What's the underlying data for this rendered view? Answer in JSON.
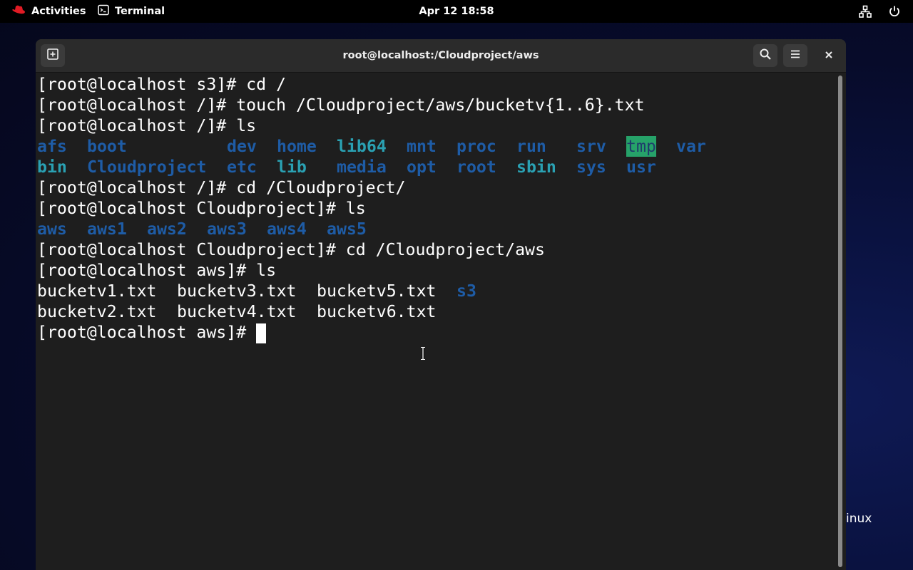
{
  "topbar": {
    "activities_label": "Activities",
    "app_label": "Terminal",
    "clock": "Apr 12  18:58"
  },
  "desktop": {
    "wallpaper_text": "inux"
  },
  "window": {
    "title": "root@localhost:/Cloudproject/aws"
  },
  "terminal": {
    "lines": [
      "[root@localhost s3]# cd /",
      "[root@localhost /]# touch /Cloudproject/aws/bucketv{1..6}.txt",
      "[root@localhost /]# ls",
      "",
      "",
      "[root@localhost /]# cd /Cloudproject/",
      "[root@localhost Cloudproject]# ls",
      "",
      "[root@localhost Cloudproject]# cd /Cloudproject/aws",
      "[root@localhost aws]# ls",
      "",
      "",
      "[root@localhost aws]# "
    ],
    "root_listing": {
      "row1": [
        "afs",
        "boot",
        "dev",
        "home",
        "lib64",
        "mnt",
        "proc",
        "run",
        "srv",
        "tmp",
        "var"
      ],
      "row2": [
        "bin",
        "Cloudproject",
        "etc",
        "lib",
        "media",
        "opt",
        "root",
        "sbin",
        "sys",
        "usr"
      ]
    },
    "cloudproject_listing": [
      "aws",
      "aws1",
      "aws2",
      "aws3",
      "aws4",
      "aws5"
    ],
    "aws_listing": {
      "row1": [
        "bucketv1.txt",
        "bucketv3.txt",
        "bucketv5.txt",
        "s3"
      ],
      "row2": [
        "bucketv2.txt",
        "bucketv4.txt",
        "bucketv6.txt"
      ]
    }
  },
  "colors": {
    "directory": "#1e5ca6",
    "symlink": "#2aa1b3",
    "sticky_bg": "#26a269",
    "terminal_bg": "#1e1e1e",
    "headerbar_bg": "#2b2b2b"
  },
  "icons": {
    "activities": "redhat-icon",
    "app": "terminal-icon",
    "network": "network-icon",
    "power": "power-icon",
    "new_tab": "new-tab-icon",
    "search": "search-icon",
    "menu": "hamburger-menu-icon",
    "close": "close-icon"
  }
}
